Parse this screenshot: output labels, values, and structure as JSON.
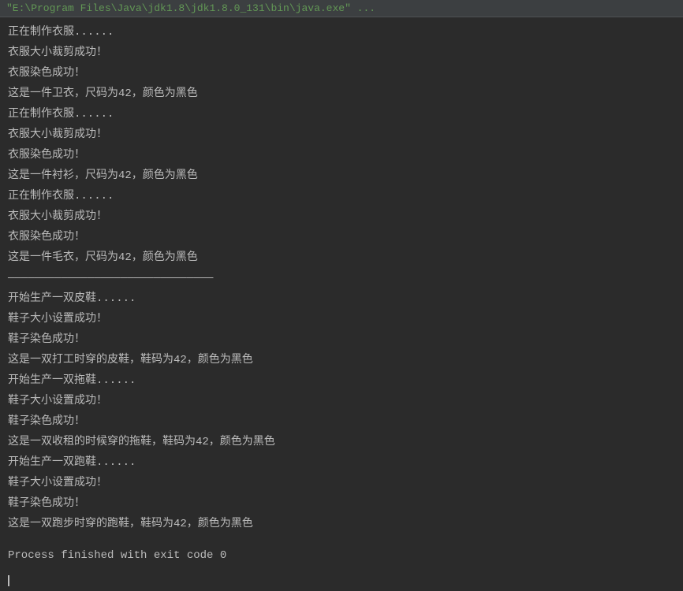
{
  "header": {
    "command": "\"E:\\Program Files\\Java\\jdk1.8\\jdk1.8.0_131\\bin\\java.exe\" ..."
  },
  "output": {
    "lines": [
      "正在制作衣服......",
      "衣服大小裁剪成功！",
      "衣服染色成功！",
      "这是一件卫衣，尺码为42，颜色为黑色",
      "正在制作衣服......",
      "衣服大小裁剪成功！",
      "衣服染色成功！",
      "这是一件衬衫，尺码为42，颜色为黑色",
      "正在制作衣服......",
      "衣服大小裁剪成功！",
      "衣服染色成功！",
      "这是一件毛衣，尺码为42，颜色为黑色",
      "———————————————————————————————",
      "开始生产一双皮鞋......",
      "鞋子大小设置成功！",
      "鞋子染色成功！",
      "这是一双打工时穿的皮鞋，鞋码为42，颜色为黑色",
      "开始生产一双拖鞋......",
      "鞋子大小设置成功！",
      "鞋子染色成功！",
      "这是一双收租的时候穿的拖鞋，鞋码为42，颜色为黑色",
      "开始生产一双跑鞋......",
      "鞋子大小设置成功！",
      "鞋子染色成功！",
      "这是一双跑步时穿的跑鞋，鞋码为42，颜色为黑色"
    ],
    "exitMessage": "Process finished with exit code 0"
  }
}
